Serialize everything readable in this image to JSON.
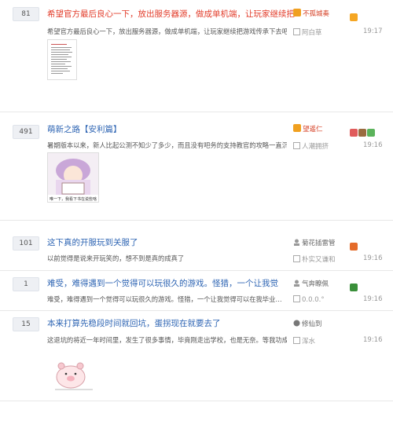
{
  "threads": [
    {
      "count": "81",
      "title": "希望官方最后良心一下，放出服务器源，做成单机端，让玩家继续把",
      "excerpt": "希望官方最后良心一下，放出服务器源，做成单机端，让玩家继续把游戏传承下去吧~",
      "author": "不孤城奏",
      "last_reply": "阿白草",
      "time": "19:17"
    },
    {
      "count": "491",
      "title": "萌新之路【安利篇】",
      "excerpt": "暑期版本以来，新人比起公测不知少了多少，而且没有吧务的支持教官的攻略一直沉…",
      "author": "望遥仁",
      "last_reply": "人潮拥挤",
      "time": "19:16",
      "thumb_caption": "唯一下，我看下书在说些啥"
    },
    {
      "count": "101",
      "title": "这下真的开服玩到关服了",
      "excerpt": "以前觉得是说来开玩笑的，想不到是真的成真了",
      "author": "菊花插雷管",
      "last_reply": "朴实又谦和",
      "time": "19:16"
    },
    {
      "count": "1",
      "title": "难受，难得遇到一个觉得可以玩很久的游戏。怪猎，一个让我觉",
      "excerpt": "难受，难得遇到一个觉得可以玩很久的游戏。怪猎，一个让我觉得可以在我毕业…",
      "author": "气奔瞭佩",
      "last_reply": "0.0.0.°",
      "time": "19:16"
    },
    {
      "count": "15",
      "title": "本来打算先稳段时间就回坑，蛋拐现在就要去了",
      "excerpt": "这退坑的将近一年时间里，发生了很多事情，毕竟刚走出学校，也是无奈。等我功成…",
      "author": "修仙到",
      "last_reply": "浑水",
      "time": "19:16"
    }
  ],
  "colors": {
    "title_red": "#e23c2a",
    "title_blue": "#2d64b3",
    "count_bg": "#eef0f4"
  }
}
